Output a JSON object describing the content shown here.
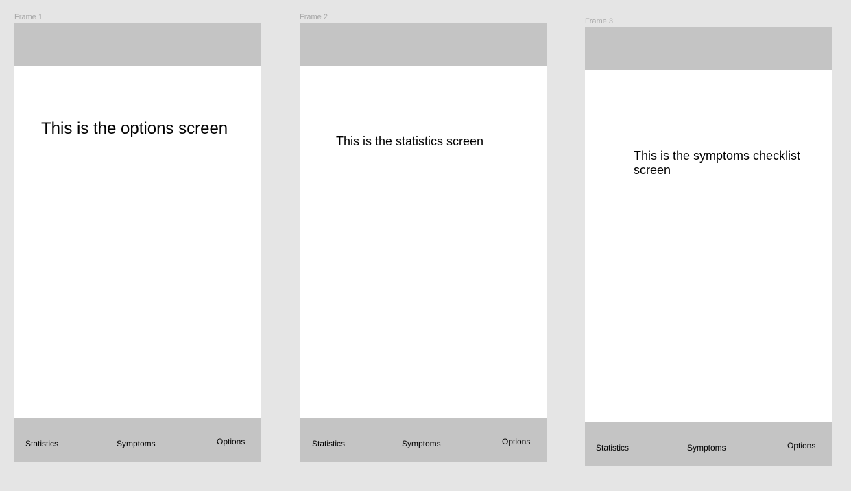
{
  "frames": [
    {
      "label": "Frame 1",
      "screen_text": "This is the options screen",
      "nav": {
        "statistics": "Statistics",
        "symptoms": "Symptoms",
        "options": "Options"
      }
    },
    {
      "label": "Frame 2",
      "screen_text": "This is the statistics screen",
      "nav": {
        "statistics": "Statistics",
        "symptoms": "Symptoms",
        "options": "Options"
      }
    },
    {
      "label": "Frame 3",
      "screen_text": "This is the symptoms checklist screen",
      "nav": {
        "statistics": "Statistics",
        "symptoms": "Symptoms",
        "options": "Options"
      }
    }
  ],
  "colors": {
    "canvas": "#e5e5e5",
    "bar": "#c4c4c4",
    "frame": "#ffffff",
    "label": "#a8a8a8"
  }
}
